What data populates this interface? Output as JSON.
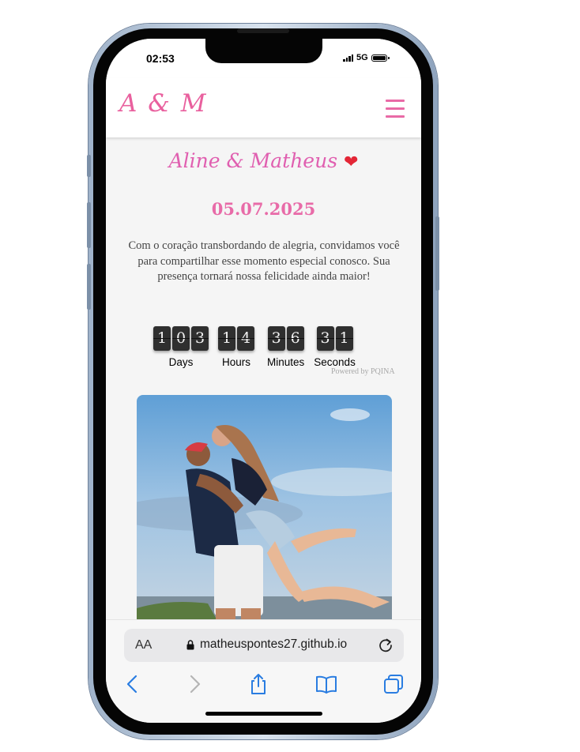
{
  "status_bar": {
    "time": "02:53",
    "network": "5G"
  },
  "header": {
    "logo": "A & M",
    "menu_icon": "hamburger-menu-icon"
  },
  "hero": {
    "couple": "Aline  &  Matheus",
    "heart": "❤",
    "date": "05.07.2025",
    "invitation": "Com o coração transbordando de alegria, convidamos você para compartilhar esse momento especial conosco. Sua presença tornará nossa felicidade ainda maior!"
  },
  "countdown": {
    "units": [
      {
        "digits": [
          "1",
          "0",
          "3"
        ],
        "label": "Days"
      },
      {
        "digits": [
          "1",
          "4"
        ],
        "label": "Hours"
      },
      {
        "digits": [
          "3",
          "6"
        ],
        "label": "Minutes"
      },
      {
        "digits": [
          "3",
          "1"
        ],
        "label": "Seconds"
      }
    ],
    "powered_by": "Powered by PQINA"
  },
  "browser": {
    "text_size_label": "AA",
    "url": "matheuspontes27.github.io",
    "icons": [
      "lock-icon",
      "reload-icon",
      "back-icon",
      "forward-icon",
      "share-icon",
      "bookmarks-icon",
      "tabs-icon"
    ]
  },
  "colors": {
    "accent_pink": "#e86ba8",
    "header_bg": "#ffffff",
    "page_bg": "#f5f5f5",
    "ios_blue": "#2a7de1",
    "countdown_tile": "#2f2f2f"
  }
}
